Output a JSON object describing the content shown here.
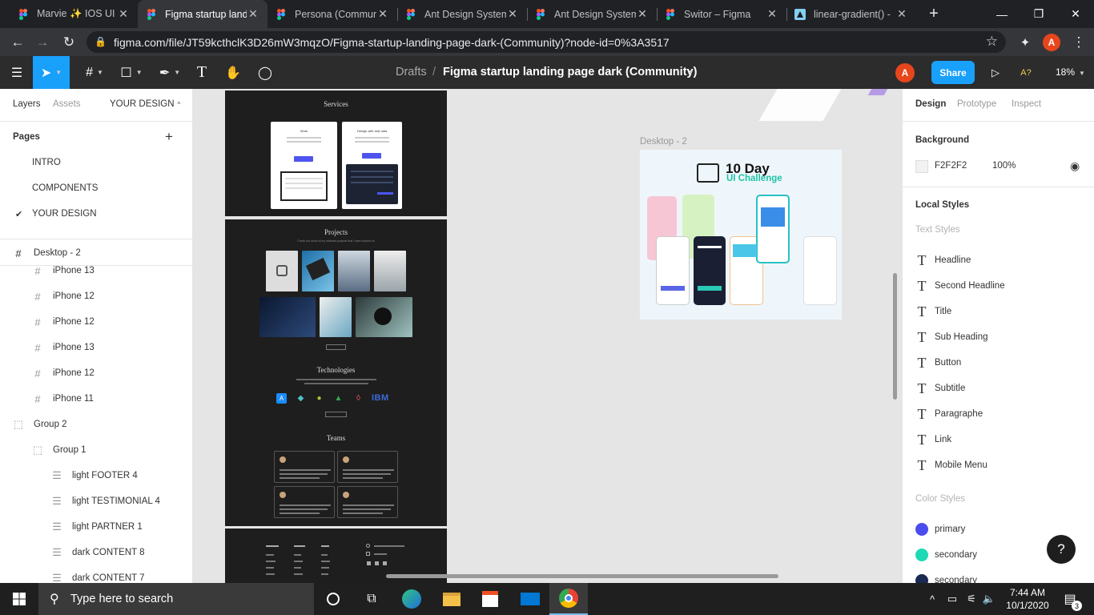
{
  "browser": {
    "tabs": [
      {
        "title": "Marvie ✨ IOS UI K",
        "icon": "figma-icon",
        "active": false
      },
      {
        "title": "Figma startup land",
        "icon": "figma-icon",
        "active": true
      },
      {
        "title": "Persona (Commun",
        "icon": "figma-icon",
        "active": false
      },
      {
        "title": "Ant Design System",
        "icon": "figma-icon",
        "active": false
      },
      {
        "title": "Ant Design System",
        "icon": "figma-icon",
        "active": false
      },
      {
        "title": "Switor – Figma",
        "icon": "figma-icon",
        "active": false
      },
      {
        "title": "linear-gradient() -",
        "icon": "mdn-icon",
        "active": false
      }
    ],
    "url": "figma.com/file/JT59kcthclK3D26mW3mqzO/Figma-startup-landing-page-dark-(Community)?node-id=0%3A3517",
    "profile_initial": "A"
  },
  "figma": {
    "toolbar": {
      "breadcrumb_parent": "Drafts",
      "breadcrumb_sep": "/",
      "file_name": "Figma startup landing page dark (Community)",
      "user_initial": "A",
      "share_label": "Share",
      "a11y_label": "A?",
      "zoom": "18%"
    },
    "left_panel": {
      "tabs": {
        "layers": "Layers",
        "assets": "Assets",
        "page_selector": "YOUR DESIGN"
      },
      "pages_title": "Pages",
      "pages": [
        "INTRO",
        "COMPONENTS",
        "YOUR DESIGN"
      ],
      "current_page": "YOUR DESIGN",
      "layers": [
        {
          "name": "Desktop - 2",
          "icon": "frame-icon"
        },
        {
          "name": "iPhone 13",
          "icon": "frame-icon"
        },
        {
          "name": "iPhone 12",
          "icon": "frame-icon"
        },
        {
          "name": "iPhone 12",
          "icon": "frame-icon"
        },
        {
          "name": "iPhone 13",
          "icon": "frame-icon"
        },
        {
          "name": "iPhone 12",
          "icon": "frame-icon"
        },
        {
          "name": "iPhone 11",
          "icon": "frame-icon"
        },
        {
          "name": "Group 2",
          "icon": "group-icon"
        },
        {
          "name": "Group 1",
          "icon": "group-icon"
        },
        {
          "name": "light FOOTER 4",
          "icon": "component-instance-icon"
        },
        {
          "name": "light TESTIMONIAL 4",
          "icon": "component-instance-icon"
        },
        {
          "name": "light PARTNER 1",
          "icon": "component-instance-icon"
        },
        {
          "name": "dark CONTENT 8",
          "icon": "component-instance-icon"
        },
        {
          "name": "dark CONTENT 7",
          "icon": "component-instance-icon"
        }
      ]
    },
    "canvas": {
      "frame_label": "Desktop - 2",
      "services_title": "Services",
      "service_cards": [
        {
          "title": "Work"
        },
        {
          "title": "Design with real data"
        }
      ],
      "projects_title": "Projects",
      "projects_subtitle": "Check out some of my selected projects that I have worked on",
      "technologies_title": "Technologies",
      "tech_logo_text": "IBM",
      "teams_title": "Teams",
      "challenge_title": "10 Day",
      "challenge_subtitle": "UI Challenge",
      "background_color": "#e5e5e5"
    },
    "right_panel": {
      "tabs": {
        "design": "Design",
        "prototype": "Prototype",
        "inspect": "Inspect"
      },
      "background_title": "Background",
      "background_hex": "F2F2F2",
      "background_opacity": "100%",
      "local_styles_title": "Local Styles",
      "text_styles_title": "Text Styles",
      "text_styles": [
        "Headline",
        "Second Headline",
        "Title",
        "Sub Heading",
        "Button",
        "Subtitle",
        "Paragraphe",
        "Link",
        "Mobile Menu"
      ],
      "color_styles_title": "Color Styles",
      "color_styles": [
        {
          "name": "primary",
          "color": "#4b4cf0"
        },
        {
          "name": "secondary",
          "color": "#1dd9b6"
        },
        {
          "name": "secondary",
          "color": "#1a2a52"
        }
      ],
      "help_label": "?"
    }
  },
  "taskbar": {
    "search_placeholder": "Type here to search",
    "time": "7:44 AM",
    "date": "10/1/2020",
    "notification_count": "3"
  }
}
